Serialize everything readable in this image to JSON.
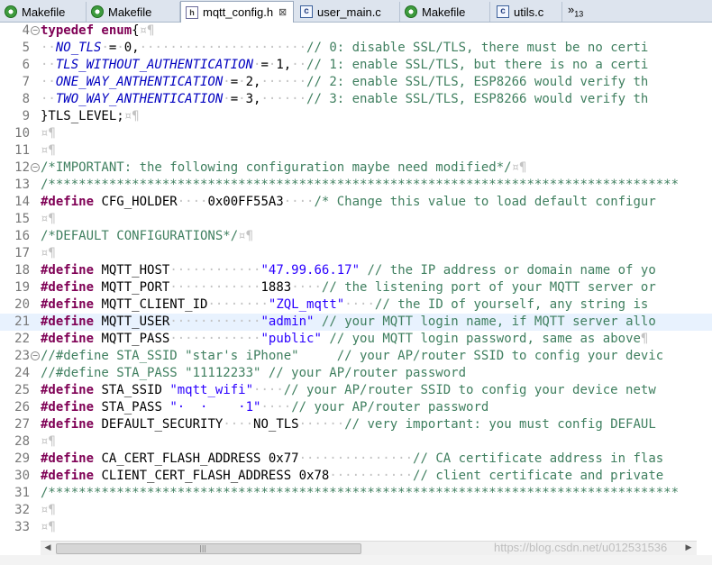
{
  "tabs": [
    {
      "label": "Makefile",
      "icon": "makefile-icon",
      "active": false
    },
    {
      "label": "Makefile",
      "icon": "makefile-icon",
      "active": false
    },
    {
      "label": "mqtt_config.h",
      "icon": "header-file-icon",
      "active": true
    },
    {
      "label": "user_main.c",
      "icon": "c-file-icon",
      "active": false
    },
    {
      "label": "Makefile",
      "icon": "makefile-icon",
      "active": false
    },
    {
      "label": "utils.c",
      "icon": "c-file-icon",
      "active": false
    }
  ],
  "overflow": {
    "label": "»",
    "count": "13"
  },
  "close_glyph": "⊠",
  "colors": {
    "keyword": "#7f0055",
    "enum_constant": "#0000c0",
    "comment": "#3f7f5f",
    "string": "#2a00ff",
    "whitespace": "#c3c3c3",
    "current_line": "#e8f2fe"
  },
  "watermark": "https://blog.csdn.net/u012531536",
  "scrollbar_grip": "|||",
  "lines": [
    {
      "n": "4",
      "fold": true,
      "segs": [
        {
          "c": "kw",
          "t": "typedef enum"
        },
        {
          "c": "",
          "t": "{"
        },
        {
          "c": "ws",
          "t": "¤¶"
        }
      ]
    },
    {
      "n": "5",
      "segs": [
        {
          "c": "ws",
          "t": "··"
        },
        {
          "c": "en",
          "t": "NO_TLS"
        },
        {
          "c": "ws",
          "t": "·"
        },
        {
          "c": "",
          "t": "="
        },
        {
          "c": "ws",
          "t": "·"
        },
        {
          "c": "",
          "t": "0,"
        },
        {
          "c": "ws",
          "t": "······················"
        },
        {
          "c": "cm",
          "t": "// 0: disable SSL/TLS, there must be no certi"
        }
      ]
    },
    {
      "n": "6",
      "segs": [
        {
          "c": "ws",
          "t": "··"
        },
        {
          "c": "en",
          "t": "TLS_WITHOUT_AUTHENTICATION"
        },
        {
          "c": "ws",
          "t": "·"
        },
        {
          "c": "",
          "t": "="
        },
        {
          "c": "ws",
          "t": "·"
        },
        {
          "c": "",
          "t": "1,"
        },
        {
          "c": "ws",
          "t": "··"
        },
        {
          "c": "cm",
          "t": "// 1: enable SSL/TLS, but there is no a certi"
        }
      ]
    },
    {
      "n": "7",
      "segs": [
        {
          "c": "ws",
          "t": "··"
        },
        {
          "c": "en",
          "t": "ONE_WAY_ANTHENTICATION"
        },
        {
          "c": "ws",
          "t": "·"
        },
        {
          "c": "",
          "t": "="
        },
        {
          "c": "ws",
          "t": "·"
        },
        {
          "c": "",
          "t": "2,"
        },
        {
          "c": "ws",
          "t": "······"
        },
        {
          "c": "cm",
          "t": "// 2: enable SSL/TLS, ESP8266 would verify th"
        }
      ]
    },
    {
      "n": "8",
      "segs": [
        {
          "c": "ws",
          "t": "··"
        },
        {
          "c": "en",
          "t": "TWO_WAY_ANTHENTICATION"
        },
        {
          "c": "ws",
          "t": "·"
        },
        {
          "c": "",
          "t": "="
        },
        {
          "c": "ws",
          "t": "·"
        },
        {
          "c": "",
          "t": "3,"
        },
        {
          "c": "ws",
          "t": "······"
        },
        {
          "c": "cm",
          "t": "// 3: enable SSL/TLS, ESP8266 would verify th"
        }
      ]
    },
    {
      "n": "9",
      "segs": [
        {
          "c": "",
          "t": "}TLS_LEVEL;"
        },
        {
          "c": "ws",
          "t": "¤¶"
        }
      ]
    },
    {
      "n": "10",
      "segs": [
        {
          "c": "ws",
          "t": "¤¶"
        }
      ]
    },
    {
      "n": "11",
      "segs": [
        {
          "c": "ws",
          "t": "¤¶"
        }
      ]
    },
    {
      "n": "12",
      "fold": true,
      "segs": [
        {
          "c": "cm",
          "t": "/*IMPORTANT: the following configuration maybe need modified*/"
        },
        {
          "c": "ws",
          "t": "¤¶"
        }
      ]
    },
    {
      "n": "13",
      "segs": [
        {
          "c": "cm",
          "t": "/***********************************************************************************"
        }
      ]
    },
    {
      "n": "14",
      "segs": [
        {
          "c": "kw",
          "t": "#define"
        },
        {
          "c": "",
          "t": " CFG_HOLDER"
        },
        {
          "c": "ws",
          "t": "····"
        },
        {
          "c": "",
          "t": "0x00FF55A3"
        },
        {
          "c": "ws",
          "t": "····"
        },
        {
          "c": "cm",
          "t": "/* Change this value to load default configur"
        }
      ]
    },
    {
      "n": "15",
      "segs": [
        {
          "c": "ws",
          "t": "¤¶"
        }
      ]
    },
    {
      "n": "16",
      "segs": [
        {
          "c": "cm",
          "t": "/*DEFAULT CONFIGURATIONS*/"
        },
        {
          "c": "ws",
          "t": "¤¶"
        }
      ]
    },
    {
      "n": "17",
      "segs": [
        {
          "c": "ws",
          "t": "¤¶"
        }
      ]
    },
    {
      "n": "18",
      "segs": [
        {
          "c": "kw",
          "t": "#define"
        },
        {
          "c": "",
          "t": " MQTT_HOST"
        },
        {
          "c": "ws",
          "t": "············"
        },
        {
          "c": "st",
          "t": "\"47.99.66.17\""
        },
        {
          "c": "ws",
          "t": " "
        },
        {
          "c": "cm",
          "t": "// the IP address or domain name of yo"
        }
      ]
    },
    {
      "n": "19",
      "segs": [
        {
          "c": "kw",
          "t": "#define"
        },
        {
          "c": "",
          "t": " MQTT_PORT"
        },
        {
          "c": "ws",
          "t": "············"
        },
        {
          "c": "",
          "t": "1883"
        },
        {
          "c": "ws",
          "t": "····"
        },
        {
          "c": "cm",
          "t": "// the listening port of your MQTT server or"
        }
      ]
    },
    {
      "n": "20",
      "segs": [
        {
          "c": "kw",
          "t": "#define"
        },
        {
          "c": "",
          "t": " MQTT_CLIENT_ID"
        },
        {
          "c": "ws",
          "t": "········"
        },
        {
          "c": "st",
          "t": "\"ZQL_mqtt\""
        },
        {
          "c": "ws",
          "t": "····"
        },
        {
          "c": "cm",
          "t": "// the ID of yourself, any string is"
        }
      ]
    },
    {
      "n": "21",
      "cur": true,
      "segs": [
        {
          "c": "kw",
          "t": "#define"
        },
        {
          "c": "",
          "t": " MQTT_USER"
        },
        {
          "c": "ws",
          "t": "············"
        },
        {
          "c": "st",
          "t": "\"admin\""
        },
        {
          "c": "ws",
          "t": " "
        },
        {
          "c": "cm",
          "t": "// your MQTT login name, if MQTT server allo"
        }
      ]
    },
    {
      "n": "22",
      "segs": [
        {
          "c": "kw",
          "t": "#define"
        },
        {
          "c": "",
          "t": " MQTT_PASS"
        },
        {
          "c": "ws",
          "t": "············"
        },
        {
          "c": "st",
          "t": "\"public\""
        },
        {
          "c": "ws",
          "t": " "
        },
        {
          "c": "cm",
          "t": "// you MQTT login password, same as above"
        },
        {
          "c": "ws",
          "t": "¶"
        }
      ]
    },
    {
      "n": "23",
      "fold": true,
      "segs": [
        {
          "c": "cm",
          "t": "//#define STA_SSID \"star's iPhone\"     // your AP/router SSID to config your devic"
        }
      ]
    },
    {
      "n": "24",
      "segs": [
        {
          "c": "cm",
          "t": "//#define STA_PASS \"11112233\" // your AP/router password"
        }
      ]
    },
    {
      "n": "25",
      "segs": [
        {
          "c": "kw",
          "t": "#define"
        },
        {
          "c": "",
          "t": " STA_SSID "
        },
        {
          "c": "st",
          "t": "\"mqtt_wifi\""
        },
        {
          "c": "ws",
          "t": "····"
        },
        {
          "c": "cm",
          "t": "// your AP/router SSID to config your device netw"
        }
      ]
    },
    {
      "n": "26",
      "segs": [
        {
          "c": "kw",
          "t": "#define"
        },
        {
          "c": "",
          "t": " STA_PASS "
        },
        {
          "c": "st",
          "t": "\"·  ·    ·1\""
        },
        {
          "c": "ws",
          "t": "····"
        },
        {
          "c": "cm",
          "t": "// your AP/router password"
        }
      ]
    },
    {
      "n": "27",
      "segs": [
        {
          "c": "kw",
          "t": "#define"
        },
        {
          "c": "",
          "t": " DEFAULT_SECURITY"
        },
        {
          "c": "ws",
          "t": "····"
        },
        {
          "c": "",
          "t": "NO_TLS"
        },
        {
          "c": "ws",
          "t": "······"
        },
        {
          "c": "cm",
          "t": "// very important: you must config DEFAUL"
        }
      ]
    },
    {
      "n": "28",
      "segs": [
        {
          "c": "ws",
          "t": "¤¶"
        }
      ]
    },
    {
      "n": "29",
      "segs": [
        {
          "c": "kw",
          "t": "#define"
        },
        {
          "c": "",
          "t": " CA_CERT_FLASH_ADDRESS 0x77"
        },
        {
          "c": "ws",
          "t": "···············"
        },
        {
          "c": "cm",
          "t": "// CA certificate address in flas"
        }
      ]
    },
    {
      "n": "30",
      "segs": [
        {
          "c": "kw",
          "t": "#define"
        },
        {
          "c": "",
          "t": " CLIENT_CERT_FLASH_ADDRESS 0x78"
        },
        {
          "c": "ws",
          "t": "···········"
        },
        {
          "c": "cm",
          "t": "// client certificate and private"
        }
      ]
    },
    {
      "n": "31",
      "segs": [
        {
          "c": "cm",
          "t": "/***********************************************************************************"
        }
      ]
    },
    {
      "n": "32",
      "segs": [
        {
          "c": "ws",
          "t": "¤¶"
        }
      ]
    },
    {
      "n": "33",
      "segs": [
        {
          "c": "ws",
          "t": "¤¶"
        }
      ]
    }
  ]
}
